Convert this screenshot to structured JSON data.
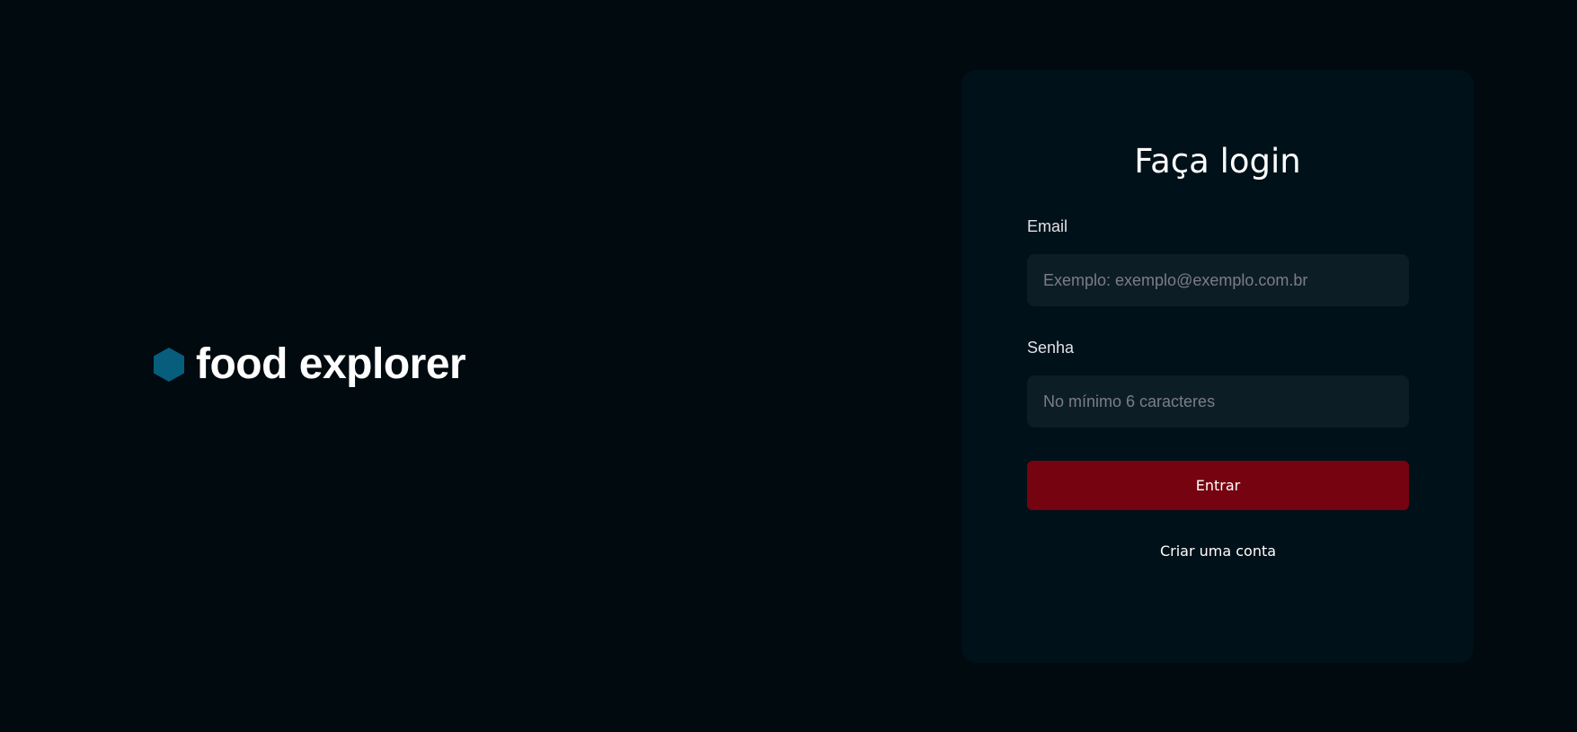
{
  "brand": {
    "name": "food explorer",
    "icon": "hexagon-icon",
    "icon_color": "#065e7c"
  },
  "login": {
    "title": "Faça login",
    "email_label": "Email",
    "email_placeholder": "Exemplo: exemplo@exemplo.com.br",
    "email_value": "",
    "password_label": "Senha",
    "password_placeholder": "No mínimo 6 caracteres",
    "password_value": "",
    "submit_label": "Entrar",
    "create_account_label": "Criar uma conta"
  },
  "colors": {
    "background": "#000a0f",
    "card": "#001119",
    "input": "#0d1d25",
    "button": "#750310"
  }
}
